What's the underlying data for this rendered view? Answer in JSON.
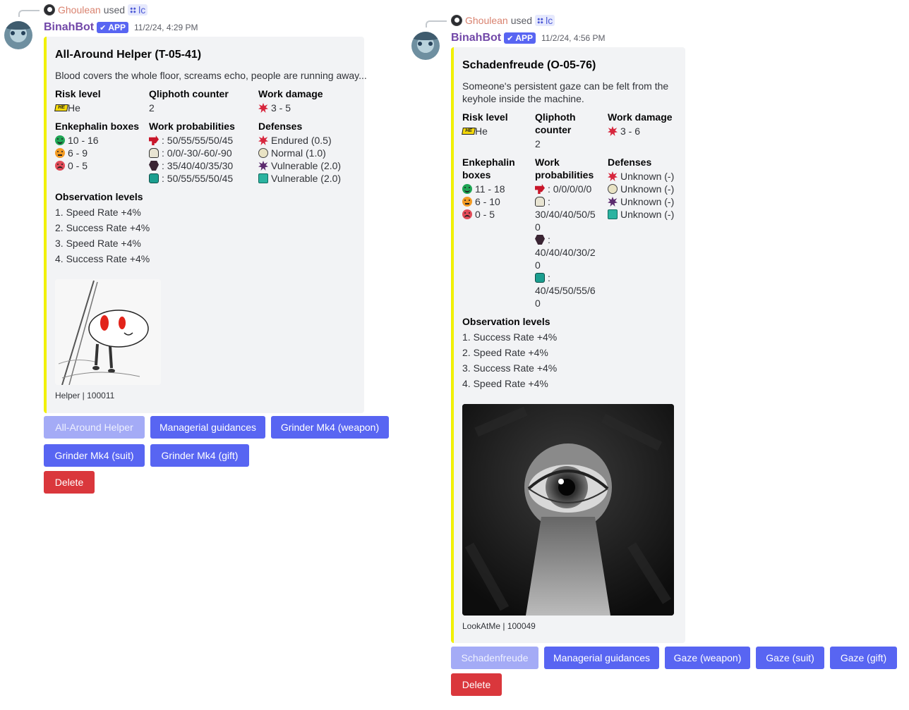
{
  "messages": [
    {
      "reply": {
        "user": "Ghoulean",
        "used": "used",
        "command": "lc"
      },
      "bot": {
        "name": "BinahBot",
        "app_tag": "APP",
        "check": "✔",
        "timestamp": "11/2/24, 4:29 PM"
      },
      "embed": {
        "title": "All-Around Helper (T-05-41)",
        "description": "Blood covers the whole floor, screams echo, people are running away...",
        "risk_level": {
          "name": "Risk level",
          "badge": "HE",
          "value": "He"
        },
        "qliphoth": {
          "name": "Qliphoth counter",
          "value": "2"
        },
        "work_damage": {
          "name": "Work damage",
          "value": "3 - 5"
        },
        "enkephalin": {
          "name": "Enkephalin boxes",
          "good": "10 - 16",
          "normal": "6 - 9",
          "bad": "0 - 5"
        },
        "work_prob": {
          "name": "Work probabilities",
          "instinct": ": 50/55/55/50/45",
          "insight": ": 0/0/-30/-60/-90",
          "attachment": ": 35/40/40/35/30",
          "repression": ": 50/55/55/50/45"
        },
        "defenses": {
          "name": "Defenses",
          "red": "Endured (0.5)",
          "white": "Normal (1.0)",
          "black": "Vulnerable (2.0)",
          "pale": "Vulnerable (2.0)"
        },
        "observation": {
          "name": "Observation levels",
          "levels": [
            "1. Speed Rate +4%",
            "2. Success Rate +4%",
            "3. Speed Rate +4%",
            "4. Success Rate +4%"
          ]
        },
        "footer": "Helper | 100011"
      },
      "buttons": {
        "b1": "All-Around Helper",
        "b2": "Managerial guidances",
        "b3": "Grinder Mk4 (weapon)",
        "b4": "Grinder Mk4 (suit)",
        "b5": "Grinder Mk4 (gift)",
        "delete": "Delete"
      }
    },
    {
      "reply": {
        "user": "Ghoulean",
        "used": "used",
        "command": "lc"
      },
      "bot": {
        "name": "BinahBot",
        "app_tag": "APP",
        "check": "✔",
        "timestamp": "11/2/24, 4:56 PM"
      },
      "embed": {
        "title": "Schadenfreude (O-05-76)",
        "description": "Someone's persistent gaze can be felt from the keyhole inside the machine.",
        "risk_level": {
          "name": "Risk level",
          "badge": "HE",
          "value": "He"
        },
        "qliphoth": {
          "name_1": "Qliphoth",
          "name_2": "counter",
          "value": "2"
        },
        "work_damage": {
          "name": "Work damage",
          "value": "3 - 6"
        },
        "enkephalin": {
          "name_1": "Enkephalin",
          "name_2": "boxes",
          "good": "11 - 18",
          "normal": "6 - 10",
          "bad": "0 - 5"
        },
        "work_prob": {
          "name_1": "Work",
          "name_2": "probabilities",
          "instinct": ": 0/0/0/0/0",
          "insight_1": ":",
          "insight_2": "30/40/40/50/5",
          "insight_3": "0",
          "attachment_1": ":",
          "attachment_2": "40/40/40/30/2",
          "attachment_3": "0",
          "repression_1": ":",
          "repression_2": "40/45/50/55/6",
          "repression_3": "0"
        },
        "defenses": {
          "name": "Defenses",
          "red": "Unknown (-)",
          "white": "Unknown (-)",
          "black": "Unknown (-)",
          "pale": "Unknown (-)"
        },
        "observation": {
          "name": "Observation levels",
          "levels": [
            "1. Success Rate +4%",
            "2. Speed Rate +4%",
            "3. Success Rate +4%",
            "4. Speed Rate +4%"
          ]
        },
        "footer": "LookAtMe | 100049"
      },
      "buttons": {
        "b1": "Schadenfreude",
        "b2": "Managerial guidances",
        "b3": "Gaze (weapon)",
        "b4": "Gaze (suit)",
        "b5": "Gaze (gift)",
        "delete": "Delete"
      }
    }
  ]
}
